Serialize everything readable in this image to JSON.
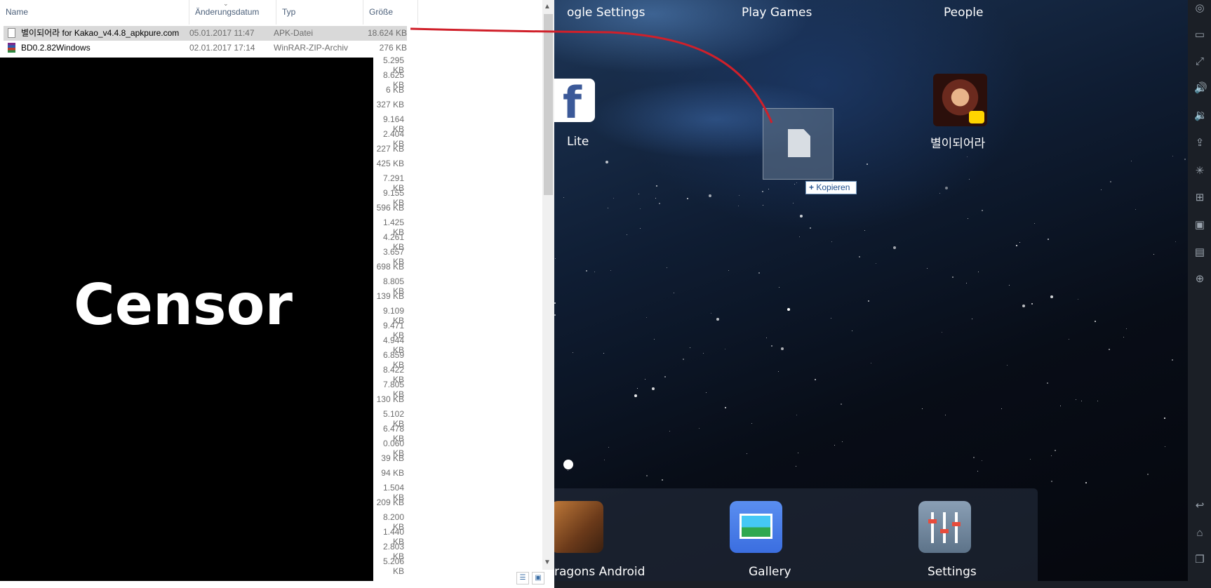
{
  "explorer": {
    "columns": {
      "name": "Name",
      "date": "Änderungsdatum",
      "type": "Typ",
      "size": "Größe"
    },
    "rows": [
      {
        "name": "별이되어라 for Kakao_v4.4.8_apkpure.com",
        "date": "05.01.2017 11:47",
        "type": "APK-Datei",
        "size": "18.624 KB"
      },
      {
        "name": "BD0.2.82Windows",
        "date": "02.01.2017 17:14",
        "type": "WinRAR-ZIP-Archiv",
        "size": "276 KB"
      }
    ],
    "visible_sizes": [
      "5.295 KB",
      "8.625 KB",
      "6 KB",
      "327 KB",
      "9.164 KB",
      "2.404 KB",
      "227 KB",
      "425 KB",
      "7.291 KB",
      "9.155 KB",
      "596 KB",
      "1.425 KB",
      "4.261 KB",
      "3.657 KB",
      "698 KB",
      "8.805 KB",
      "139 KB",
      "9.109 KB",
      "9.471 KB",
      "4.944 KB",
      "6.859 KB",
      "8.422 KB",
      "7.805 KB",
      "130 KB",
      "5.102 KB",
      "6.478 KB",
      "0.060 KB",
      "39 KB",
      "94 KB",
      "1.504 KB",
      "209 KB",
      "8.200 KB",
      "1.440 KB",
      "2.803 KB",
      "5.206 KB"
    ],
    "censor_text": "Censor"
  },
  "android": {
    "top_apps": [
      "ogle Settings",
      "Play Games",
      "People"
    ],
    "apps": {
      "facebook_lite": "Lite",
      "game": "별이되어라"
    },
    "drag_tooltip": "Kopieren",
    "dock": [
      "ragons Android",
      "Gallery",
      "Settings"
    ]
  },
  "sidebar_icons": [
    "location-icon",
    "keyboard-icon",
    "fullscreen-icon",
    "volume-up-icon",
    "volume-down-icon",
    "upload-apk-icon",
    "shake-icon",
    "mouse-icon",
    "camera-icon",
    "toolbox-icon",
    "add-icon",
    "back-icon",
    "home-icon",
    "recent-apps-icon"
  ],
  "colors": {
    "drag_line": "#d0202a",
    "accent": "#1f4e8c"
  }
}
